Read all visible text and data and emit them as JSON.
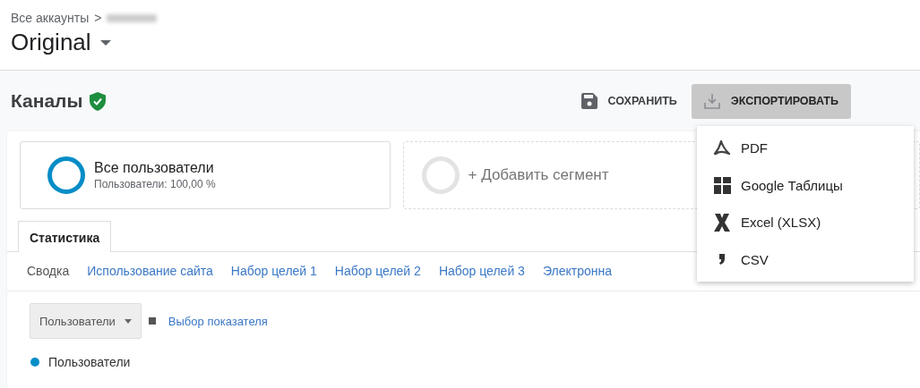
{
  "breadcrumb": {
    "parent": "Все аккаунты",
    "separator": ">",
    "redacted": true
  },
  "view": {
    "name": "Original"
  },
  "report": {
    "title": "Каналы",
    "verified": true
  },
  "actions": [
    {
      "kind": "save",
      "label": "СОХРАНИТЬ",
      "selected": false
    },
    {
      "kind": "export",
      "label": "ЭКСПОРТИРОВАТЬ",
      "selected": true
    }
  ],
  "segments": [
    {
      "kind": "active",
      "name": "Все пользователи",
      "detail": "Пользователи: 100,00 %"
    },
    {
      "kind": "add",
      "name": "+ Добавить сегмент"
    }
  ],
  "tabs": [
    {
      "label": "Статистика",
      "selected": true
    }
  ],
  "subtabs": [
    {
      "label": "Сводка",
      "selected": true
    },
    {
      "label": "Использование сайта",
      "selected": false
    },
    {
      "label": "Набор целей 1",
      "selected": false
    },
    {
      "label": "Набор целей 2",
      "selected": false
    },
    {
      "label": "Набор целей 3",
      "selected": false
    },
    {
      "label": "Электронна",
      "selected": false
    }
  ],
  "metric_select": {
    "value": "Пользователи"
  },
  "metric_link": "Выбор показателя",
  "legend": [
    {
      "label": "Пользователи",
      "color": "#058dc7"
    }
  ],
  "export_menu": [
    {
      "kind": "pdf",
      "label": "PDF"
    },
    {
      "kind": "sheets",
      "label": "Google Таблицы"
    },
    {
      "kind": "excel",
      "label": "Excel (XLSX)"
    },
    {
      "kind": "csv",
      "label": "CSV"
    }
  ]
}
